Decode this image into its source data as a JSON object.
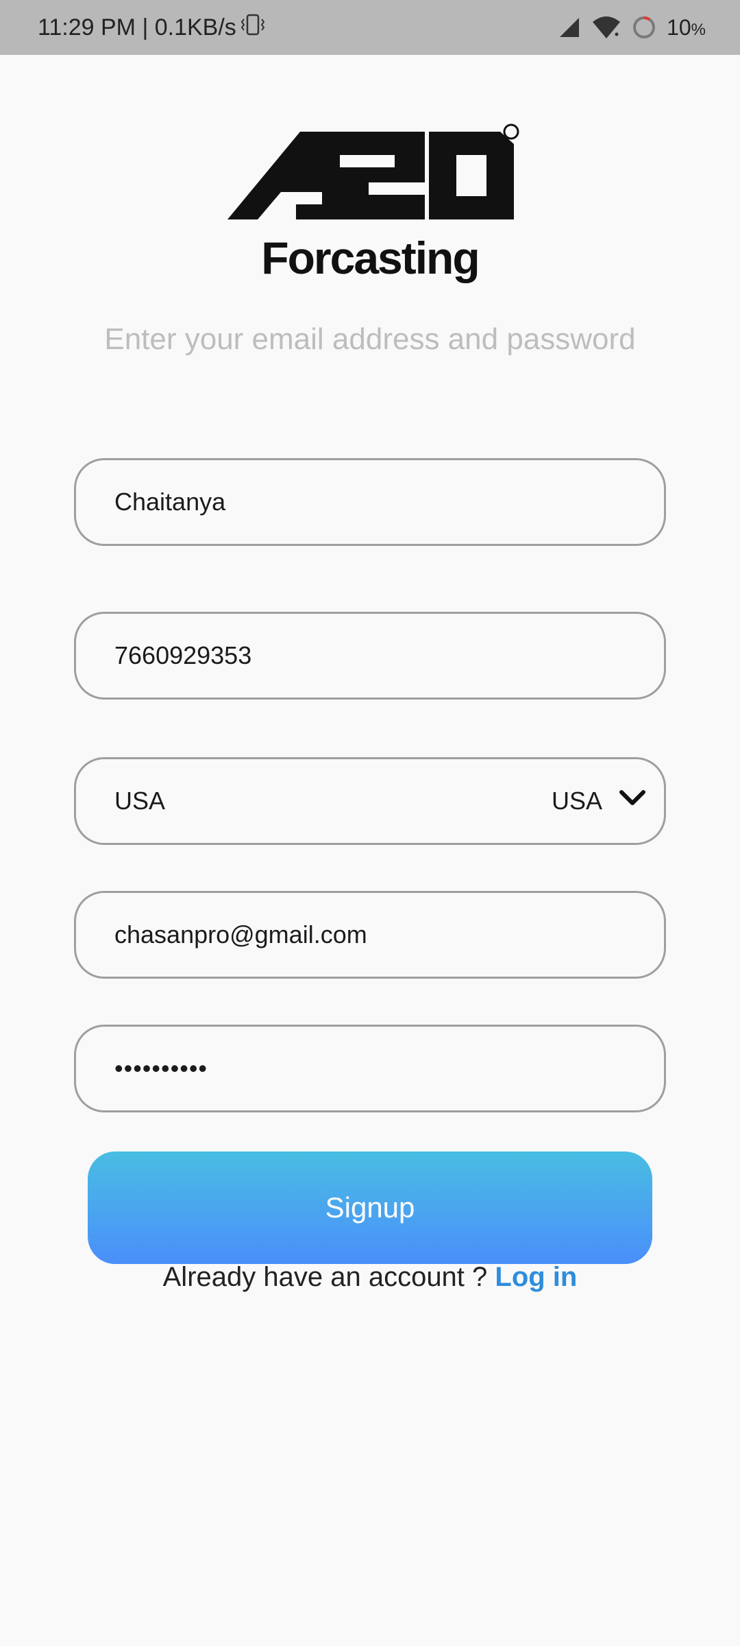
{
  "status_bar": {
    "time_speed": "11:29 PM | 0.1KB/s",
    "battery_percent": "10",
    "battery_unit": "%"
  },
  "logo": {
    "registered_mark": "®",
    "app_name": "Forcasting"
  },
  "subtitle": "Enter your email address and password",
  "form": {
    "name_value": "Chaitanya",
    "phone_value": "7660929353",
    "country_value": "USA",
    "country_selected": "USA",
    "email_value": "chasanpro@gmail.com",
    "password_masked": "••••••••••"
  },
  "signup": {
    "label": "Signup"
  },
  "login": {
    "prompt": "Already have an account ? ",
    "link_label": "Log in"
  }
}
